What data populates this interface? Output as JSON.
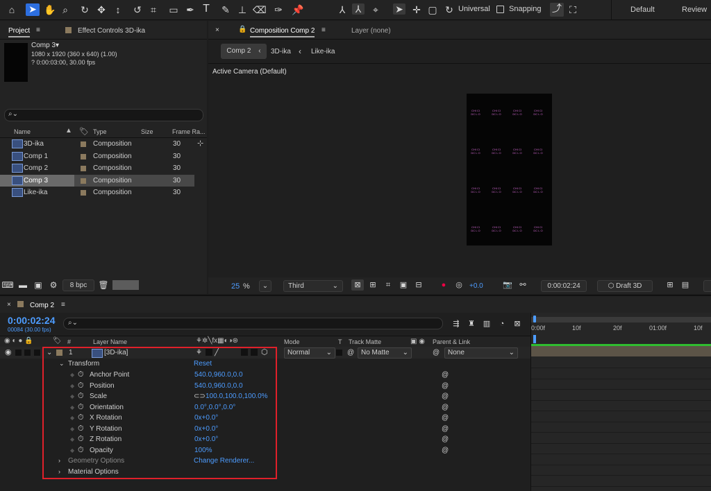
{
  "toolbar": {
    "universal_label": "Universal",
    "snapping_label": "Snapping",
    "workspace_default": "Default",
    "workspace_review": "Review"
  },
  "project_panel": {
    "tab_label": "Project",
    "effect_controls_tab": "Effect Controls 3D-ika",
    "selected_name": "Comp 3▾",
    "selected_dims": "1080 x 1920  (360 x 640) (1.00)",
    "selected_duration": "? 0:00:03:00, 30.00 fps",
    "columns": {
      "name": "Name",
      "type": "Type",
      "size": "Size",
      "frame_rate": "Frame Ra..."
    },
    "items": [
      {
        "name": "3D-ika",
        "type": "Composition",
        "fps": "30"
      },
      {
        "name": "Comp 1",
        "type": "Composition",
        "fps": "30"
      },
      {
        "name": "Comp 2",
        "type": "Composition",
        "fps": "30"
      },
      {
        "name": "Comp 3",
        "type": "Composition",
        "fps": "30"
      },
      {
        "name": "Like-ika",
        "type": "Composition",
        "fps": "30"
      }
    ],
    "bpc_label": "8 bpc"
  },
  "composition_panel": {
    "tab_label": "Composition Comp 2",
    "layer_tab": "Layer (none)",
    "breadcrumbs": [
      "Comp 2",
      "3D-ika",
      "Like-ika"
    ],
    "camera_label": "Active Camera (Default)",
    "zoom": "25",
    "zoom_unit": "%",
    "resolution": "Third",
    "exposure": "+0.0",
    "timecode": "0:00:02:24",
    "renderer": "Draft 3D"
  },
  "timeline": {
    "tab_label": "Comp 2",
    "timecode": "0:00:02:24",
    "frames": "00084 (30.00 fps)",
    "ruler": [
      "0:00f",
      "10f",
      "20f",
      "01:00f",
      "10f"
    ],
    "headers": {
      "layer_name": "Layer Name",
      "mode": "Mode",
      "t": "T",
      "track_matte": "Track Matte",
      "parent": "Parent & Link"
    },
    "layer": {
      "index": "1",
      "name": "[3D-ika]",
      "mode": "Normal",
      "matte": "No Matte",
      "parent": "None"
    },
    "transform_label": "Transform",
    "reset_label": "Reset",
    "properties": [
      {
        "name": "Anchor Point",
        "value": "540.0,960.0,0.0"
      },
      {
        "name": "Position",
        "value": "540.0,960.0,0.0"
      },
      {
        "name": "Scale",
        "value": "100.0,100.0,100.0%"
      },
      {
        "name": "Orientation",
        "value": "0.0°,0.0°,0.0°"
      },
      {
        "name": "X Rotation",
        "value": "0x+0.0°"
      },
      {
        "name": "Y Rotation",
        "value": "0x+0.0°"
      },
      {
        "name": "Z Rotation",
        "value": "0x+0.0°"
      },
      {
        "name": "Opacity",
        "value": "100%"
      }
    ],
    "geometry_label": "Geometry Options",
    "geometry_value": "Change Renderer...",
    "material_label": "Material Options"
  },
  "preview_tile_text": "CHI CI DC\nL O",
  "colors": {
    "accent": "#4d9cff",
    "highlight_box": "#e0202a",
    "green_bar": "#2fbd2f"
  }
}
